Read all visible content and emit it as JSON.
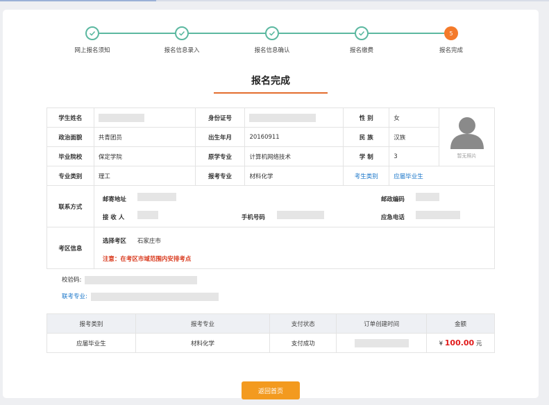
{
  "stepper": {
    "steps": [
      {
        "label": "网上报名须知"
      },
      {
        "label": "报名信息录入"
      },
      {
        "label": "报名信息确认"
      },
      {
        "label": "报名缴费"
      },
      {
        "label": "报名完成",
        "number": "5"
      }
    ]
  },
  "page_title": "报名完成",
  "info": {
    "labels": {
      "name": "学生姓名",
      "id_number": "身份证号",
      "gender": "性 别",
      "political": "政治面貌",
      "birth": "出生年月",
      "ethnicity": "民 族",
      "school": "毕业院校",
      "original_major": "原学专业",
      "schooling": "学 制",
      "major_category": "专业类别",
      "apply_major": "报考专业",
      "candidate_type": "考生类别",
      "contact": "联系方式",
      "mail_address": "邮寄地址",
      "postcode": "邮政编码",
      "receiver": "接 收 人",
      "mobile": "手机号码",
      "emergency": "应急电话",
      "exam_area": "考区信息",
      "select_area": "选择考区"
    },
    "values": {
      "gender": "女",
      "political": "共青团员",
      "birth": "20160911",
      "ethnicity": "汉族",
      "school": "保定学院",
      "original_major": "计算机网络技术",
      "schooling": "3",
      "major_category": "理工",
      "apply_major": "材料化学",
      "candidate_type": "应届毕业生",
      "select_area": "石家庄市"
    },
    "photo_caption": "暂无照片",
    "note": "注意：在考区市域范围内安排考点"
  },
  "extra": {
    "check_code_label": "校验码:",
    "joint_major_label": "联考专业:"
  },
  "payment": {
    "headers": [
      "报考类别",
      "报考专业",
      "支付状态",
      "订单创建时间",
      "金额"
    ],
    "row": {
      "category": "应届毕业生",
      "major": "材料化学",
      "status": "支付成功",
      "currency": "¥",
      "amount": "100.00",
      "unit": "元"
    }
  },
  "home_button": "返回首页",
  "colors": {
    "accent": "#f47a2a",
    "step": "#5bb8a0",
    "link": "#1a76c9",
    "price": "#e11b1b"
  }
}
